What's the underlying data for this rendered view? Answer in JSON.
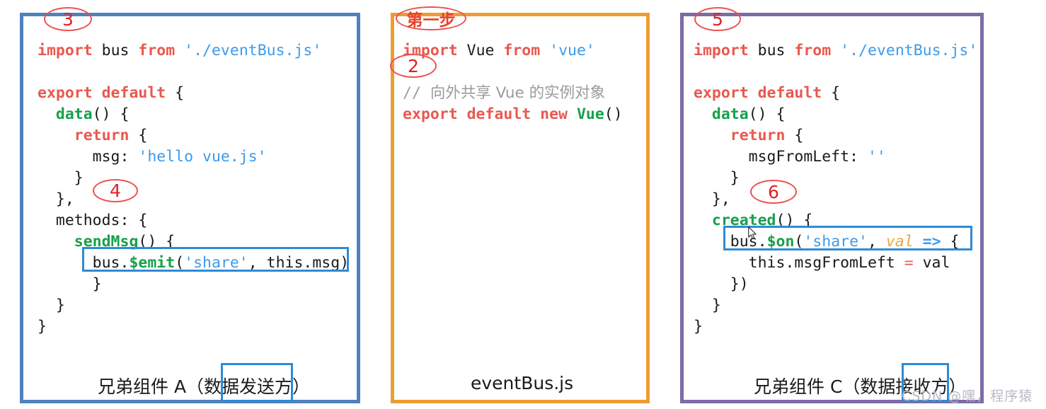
{
  "panels": [
    {
      "id": "panel-a",
      "border_color": "#4f81bd",
      "caption": "兄弟组件 A（数据发送方）",
      "caption_box_text": "发送方）",
      "code_lines": [
        "import bus from './eventBus.js'",
        "",
        "export default {",
        "  data() {",
        "    return {",
        "      msg: 'hello vue.js'",
        "    }",
        "  },",
        "  methods: {",
        "    sendMsg() {",
        "      bus.$emit('share', this.msg)",
        "    }",
        "  }",
        "}"
      ],
      "highlighted_line": "bus.$emit('share', this.msg)",
      "annotations": [
        {
          "label": "3"
        },
        {
          "label": "4"
        }
      ]
    },
    {
      "id": "panel-b",
      "border_color": "#ed9c33",
      "caption": "eventBus.js",
      "code_lines": [
        "import Vue from 'vue'",
        "",
        "// 向外共享 Vue 的实例对象",
        "export default new Vue()"
      ],
      "annotations": [
        {
          "label": "第一步"
        },
        {
          "label": "2"
        }
      ]
    },
    {
      "id": "panel-c",
      "border_color": "#7d6ba6",
      "caption": "兄弟组件 C（数据接收方）",
      "caption_box_text": "接收方",
      "code_lines": [
        "import bus from './eventBus.js'",
        "",
        "export default {",
        "  data() {",
        "    return {",
        "      msgFromLeft: ''",
        "    }",
        "  },",
        "  created() {",
        "    bus.$on('share', val => {",
        "      this.msgFromLeft = val",
        "    })",
        "  }",
        "}"
      ],
      "highlighted_line": "bus.$on('share', val => {",
      "annotations": [
        {
          "label": "5"
        },
        {
          "label": "6"
        }
      ]
    }
  ],
  "annotations": {
    "a3": "3",
    "a4": "4",
    "step1": "第一步",
    "a2": "2",
    "a5": "5",
    "a6": "6"
  },
  "captions": {
    "panel_a": "兄弟组件 A（数据发送方）",
    "panel_b": "eventBus.js",
    "panel_c": "兄弟组件 C（数据接收方）"
  },
  "watermark": "CSDN @嘿，程序猿",
  "colors": {
    "panel_a_border": "#4f81bd",
    "panel_b_border": "#ed9c33",
    "panel_c_border": "#7d6ba6",
    "highlight_box": "#2e8bd6",
    "annotation_red": "#ed5050",
    "keyword": "#e8594f",
    "function": "#17a04a",
    "string": "#3e9bea",
    "comment": "#9b9b9b"
  }
}
